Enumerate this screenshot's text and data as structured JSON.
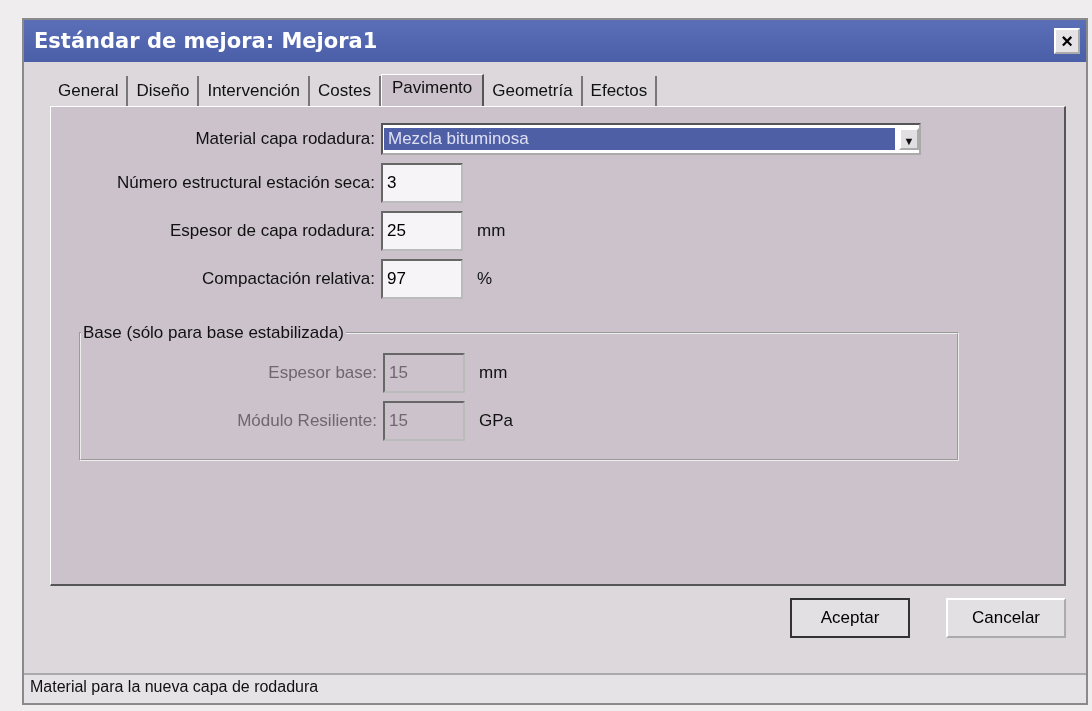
{
  "window": {
    "title": "Estándar de mejora: Mejora1",
    "close": "×"
  },
  "tabs": [
    {
      "label": "General",
      "selected": false
    },
    {
      "label": "Diseño",
      "selected": false
    },
    {
      "label": "Intervención",
      "selected": false
    },
    {
      "label": "Costes",
      "selected": false
    },
    {
      "label": "Pavimento",
      "selected": true
    },
    {
      "label": "Geometría",
      "selected": false
    },
    {
      "label": "Efectos",
      "selected": false
    }
  ],
  "material": {
    "label": "Material capa rodadura:",
    "value": "Mezcla bituminosa",
    "arrow": "▼"
  },
  "fields": [
    {
      "label": "Número estructural estación seca:",
      "value": "3",
      "disabled": false
    },
    {
      "label": "Espesor de capa rodadura:",
      "value": "25",
      "unit": "mm",
      "disabled": false
    },
    {
      "label": "Compactación relativa:",
      "value": "97",
      "unit": "%",
      "disabled": false
    }
  ],
  "base_group": {
    "title": "Base (sólo para base estabilizada)",
    "fields": [
      {
        "label": "Espesor base:",
        "value": "15",
        "unit": "mm",
        "disabled": true
      },
      {
        "label": "Módulo Resiliente:",
        "value": "15",
        "unit": "GPa",
        "disabled": true
      }
    ]
  },
  "buttons": [
    {
      "label": "Aceptar",
      "default": true
    },
    {
      "label": "Cancelar",
      "default": false
    }
  ],
  "status_bar": "Material para la nueva capa de rodadura"
}
